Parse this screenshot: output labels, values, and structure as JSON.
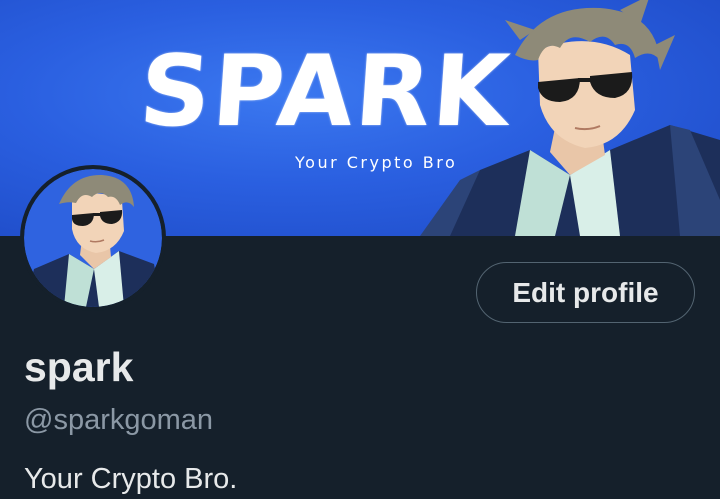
{
  "banner": {
    "title": "SPARK",
    "subtitle": "Your Crypto Bro",
    "background_color": "#2a5fe0"
  },
  "profile": {
    "display_name": "spark",
    "handle": "@sparkgoman",
    "bio": "Your Crypto Bro."
  },
  "actions": {
    "edit_profile_label": "Edit profile"
  },
  "theme": {
    "background": "#15202b",
    "text_primary": "#e7e9ea",
    "text_secondary": "#8b98a5",
    "border": "#536471"
  }
}
